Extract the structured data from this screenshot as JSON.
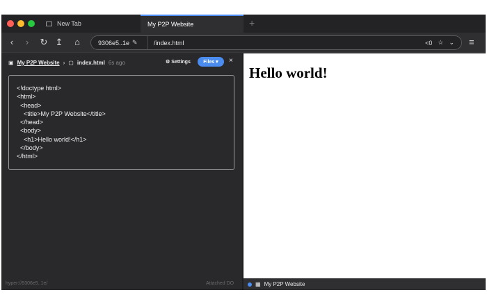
{
  "window": {
    "traffic_lights": [
      "#ff5f57",
      "#febc2e",
      "#28c840"
    ]
  },
  "tabs": [
    {
      "label": "New Tab",
      "active": false
    },
    {
      "label": "My P2P Website",
      "active": true
    }
  ],
  "nav": {
    "back": "‹",
    "forward": "›",
    "reload": "↻",
    "upload": "↥",
    "home": "⌂",
    "new_tab": "+",
    "menu": "≡"
  },
  "urlbar": {
    "host": "9306e5..1e",
    "path": "/index.html",
    "peers": "0",
    "peers_icon": "share-icon",
    "bookmark_icon": "star-icon",
    "dropdown_icon": "chevron-down-icon"
  },
  "editor_panel": {
    "site_name": "My P2P Website",
    "file_name": "index.html",
    "modified": "6s ago",
    "settings_label": "Settings",
    "files_label": "Files",
    "close_label": "×",
    "code_lines": [
      "<!doctype html>",
      "<html>",
      "  <head>",
      "    <title>My P2P Website</title>",
      "  </head>",
      "  <body>",
      "    <h1>Hello world!</h1>",
      "  </body>",
      "</html>"
    ],
    "status_left": "hyper://9306e5..1e/",
    "status_right": "Attached DO"
  },
  "preview": {
    "heading": "Hello world!",
    "footer_label": "My P2P Website"
  },
  "colors": {
    "accent": "#4b8cf0",
    "chrome_dark": "#2b2b2d"
  }
}
